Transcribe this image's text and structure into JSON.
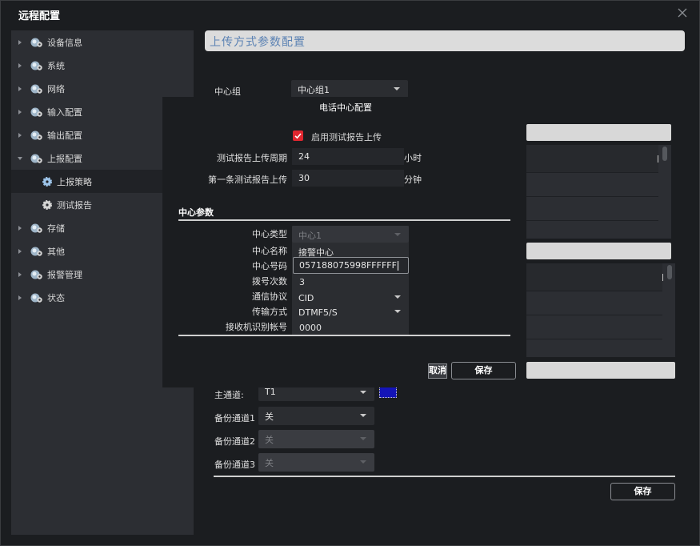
{
  "window": {
    "title": "远程配置",
    "close_icon": "close-icon"
  },
  "sidebar": {
    "items": [
      {
        "label": "设备信息",
        "expanded": false,
        "icon": "gear-globe-icon"
      },
      {
        "label": "系统",
        "expanded": false,
        "icon": "gear-globe-icon"
      },
      {
        "label": "网络",
        "expanded": false,
        "icon": "gear-globe-icon"
      },
      {
        "label": "输入配置",
        "expanded": false,
        "icon": "gear-globe-icon"
      },
      {
        "label": "输出配置",
        "expanded": false,
        "icon": "gear-globe-icon"
      },
      {
        "label": "上报配置",
        "expanded": true,
        "icon": "gear-globe-icon",
        "children": [
          {
            "label": "上报策略",
            "selected": true,
            "icon": "gear-icon"
          },
          {
            "label": "测试报告",
            "selected": false,
            "icon": "gear-icon"
          }
        ]
      },
      {
        "label": "存储",
        "expanded": false,
        "icon": "gear-globe-icon"
      },
      {
        "label": "其他",
        "expanded": false,
        "icon": "gear-globe-icon"
      },
      {
        "label": "报警管理",
        "expanded": false,
        "icon": "gear-globe-icon"
      },
      {
        "label": "状态",
        "expanded": false,
        "icon": "gear-globe-icon"
      }
    ]
  },
  "main": {
    "header": "上传方式参数配置",
    "center_group_label": "中心组",
    "center_group_value": "中心组1",
    "channels": {
      "main_label": "主通道:",
      "main_value": "T1",
      "backup1_label": "备份通道1",
      "backup1_value": "关",
      "backup2_label": "备份通道2",
      "backup2_value": "关",
      "backup3_label": "备份通道3",
      "backup3_value": "关"
    },
    "save_label": "保存"
  },
  "dialog": {
    "title": "电话中心配置",
    "enable_test_report_label": "启用测试报告上传",
    "enable_test_report_checked": true,
    "test_period_label": "测试报告上传周期",
    "test_period_value": "24",
    "test_period_unit": "小时",
    "first_report_label": "第一条测试报告上传",
    "first_report_value": "30",
    "first_report_unit": "分钟",
    "section_title": "中心参数",
    "params": {
      "center_type_label": "中心类型",
      "center_type_value": "中心1",
      "center_name_label": "中心名称",
      "center_name_value": "接警中心",
      "center_number_label": "中心号码",
      "center_number_value": "057188075998FFFFFF",
      "dial_count_label": "拨号次数",
      "dial_count_value": "3",
      "protocol_label": "通信协议",
      "protocol_value": "CID",
      "transfer_label": "传输方式",
      "transfer_value": "DTMF5/S",
      "receiver_id_label": "接收机识别帐号",
      "receiver_id_value": "0000"
    },
    "cancel_label": "取消",
    "save_label": "保存"
  },
  "colors": {
    "background": "#1b1d20",
    "sidebar": "#2c2e33",
    "header_text": "#5b82b3",
    "checkbox": "#e0262f",
    "focus": "#1414b8"
  }
}
